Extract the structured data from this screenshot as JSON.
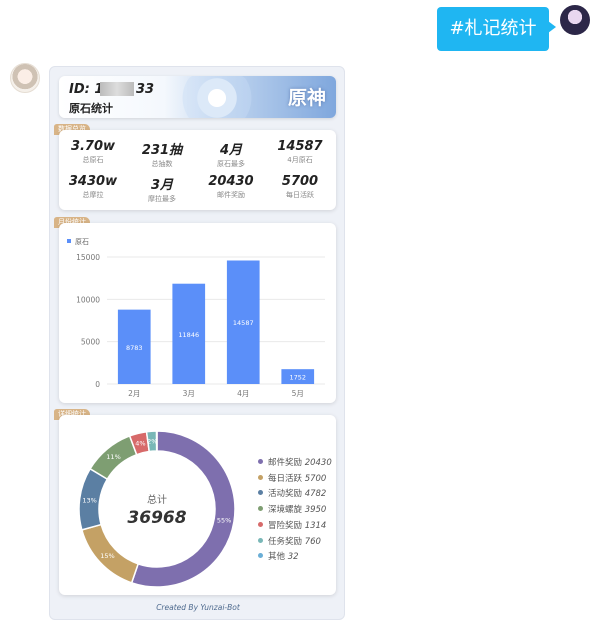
{
  "chat": {
    "user_message": "#札记统计"
  },
  "card": {
    "id_prefix": "ID: 18",
    "id_suffix": "33",
    "title": "原石统计",
    "logo_text": "原神",
    "footer": "Created By Yunzai-Bot"
  },
  "sections": {
    "summary_tag": "数据总览",
    "monthly_tag": "月份统计",
    "detail_tag": "详细统计"
  },
  "summary": [
    {
      "value": "3.70w",
      "label": "总原石"
    },
    {
      "value": "231抽",
      "label": "总抽数"
    },
    {
      "value": "4月",
      "label": "原石最多"
    },
    {
      "value": "14587",
      "label": "4月原石"
    },
    {
      "value": "3430w",
      "label": "总摩拉"
    },
    {
      "value": "3月",
      "label": "摩拉最多"
    },
    {
      "value": "20430",
      "label": "邮件奖励"
    },
    {
      "value": "5700",
      "label": "每日活跃"
    }
  ],
  "chart_data": [
    {
      "type": "bar",
      "title": "",
      "legend": [
        "原石"
      ],
      "legend_position": "top-left",
      "categories": [
        "2月",
        "3月",
        "4月",
        "5月"
      ],
      "series": [
        {
          "name": "原石",
          "values": [
            8783,
            11846,
            14587,
            1752
          ]
        }
      ],
      "ylim": [
        0,
        15000
      ],
      "yticks": [
        0,
        5000,
        10000,
        15000
      ],
      "grid": true,
      "color": "#5b8ff9"
    },
    {
      "type": "pie",
      "donut": true,
      "center_label": "总计",
      "center_value": "36968",
      "legend_position": "right",
      "slices": [
        {
          "name": "邮件奖励",
          "value": 20430,
          "label": "55%",
          "color": "#7e6fae"
        },
        {
          "name": "每日活跃",
          "value": 5700,
          "label": "15%",
          "color": "#c4a165"
        },
        {
          "name": "活动奖励",
          "value": 4782,
          "label": "13%",
          "color": "#5b7fa3"
        },
        {
          "name": "深境螺旋",
          "value": 3950,
          "label": "11%",
          "color": "#7e9e72"
        },
        {
          "name": "冒险奖励",
          "value": 1314,
          "label": "4%",
          "color": "#d76a6a"
        },
        {
          "name": "任务奖励",
          "value": 760,
          "label": "2%",
          "color": "#79b7b7"
        },
        {
          "name": "其他",
          "value": 32,
          "label": "",
          "color": "#6aaed6"
        }
      ]
    }
  ]
}
